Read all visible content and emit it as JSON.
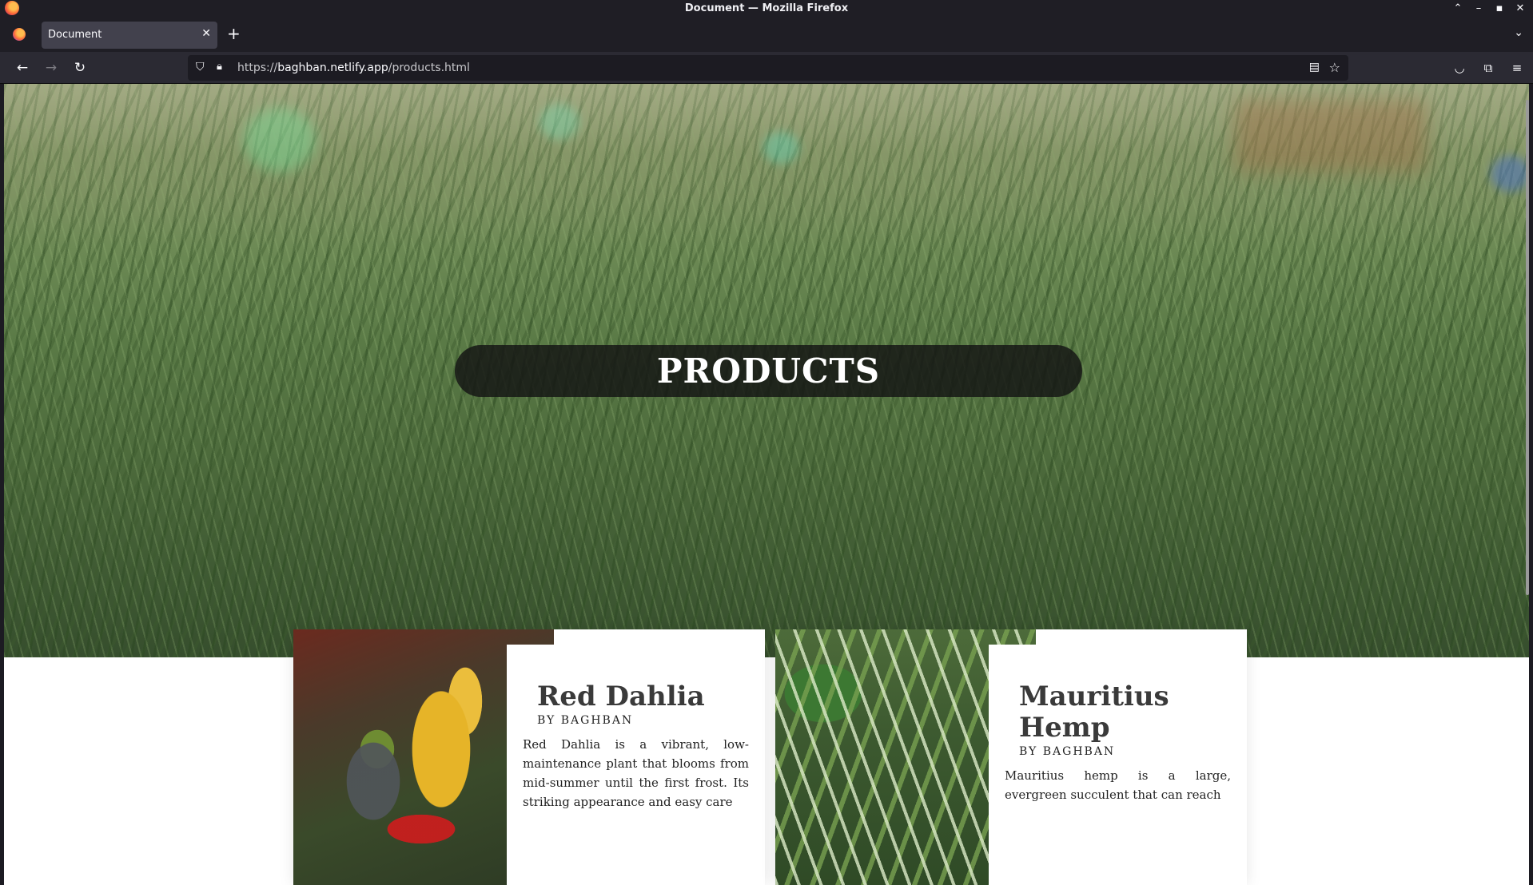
{
  "window": {
    "title": "Document — Mozilla Firefox"
  },
  "tabs": [
    {
      "label": "Document",
      "active": true
    }
  ],
  "navigation": {
    "url_prefix": "https://",
    "url_domain": "baghban.netlify.app",
    "url_path": "/products.html"
  },
  "hero": {
    "title": "PRODUCTS"
  },
  "products": [
    {
      "name": "Red Dahlia",
      "byline": "BY BAGHBAN",
      "description": "Red Dahlia is a vibrant, low-maintenance plant that blooms from mid-summer until the first frost. Its striking appearance and easy care"
    },
    {
      "name": "Mauritius Hemp",
      "byline": "BY BAGHBAN",
      "description": "Mauritius hemp is a large, evergreen succulent that can reach"
    }
  ],
  "icons": {
    "back": "back-arrow-icon",
    "forward": "forward-arrow-icon",
    "reload": "reload-icon",
    "shield": "tracking-shield-icon",
    "lock": "lock-icon",
    "reader": "reader-view-icon",
    "bookmark": "bookmark-star-icon",
    "pocket": "pocket-icon",
    "extensions": "extensions-icon",
    "menu": "hamburger-menu-icon"
  },
  "colors": {
    "chrome_dark": "#1f1e25",
    "toolbar": "#2b2a33",
    "hero_pill": "#141414",
    "heading_text": "#3a3a3a"
  }
}
